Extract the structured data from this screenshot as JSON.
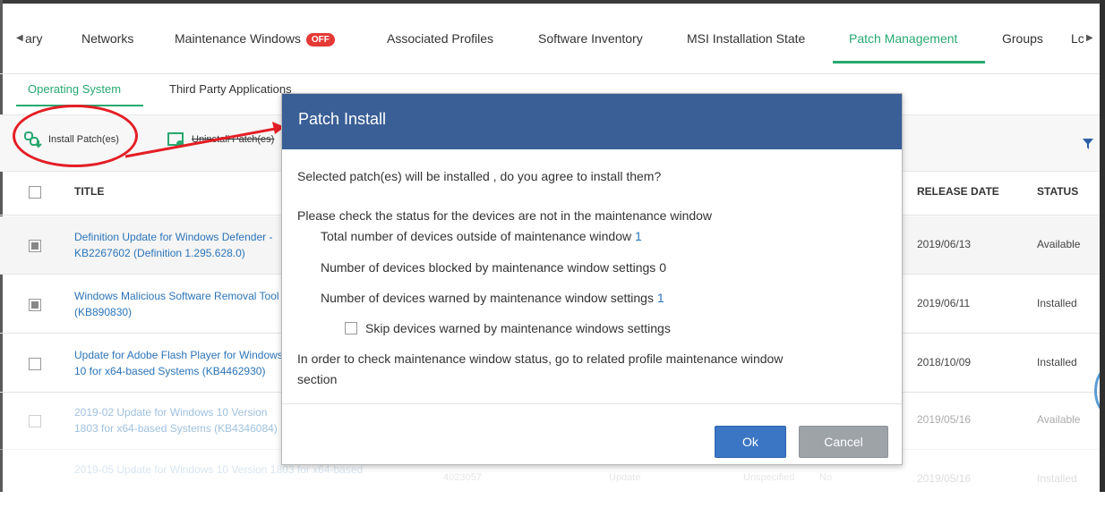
{
  "tabs": {
    "items": [
      {
        "label": "ary"
      },
      {
        "label": "Networks"
      },
      {
        "label": "Maintenance Windows",
        "badge": "OFF"
      },
      {
        "label": "Associated Profiles"
      },
      {
        "label": "Software Inventory"
      },
      {
        "label": "MSI Installation State"
      },
      {
        "label": "Patch Management",
        "active": true
      },
      {
        "label": "Groups"
      },
      {
        "label": "Lc"
      }
    ]
  },
  "subtabs": {
    "operating_system": "Operating System",
    "third_party": "Third Party Applications"
  },
  "toolbar": {
    "install_label": "Install Patch(es)",
    "uninstall_label": "Uninstall Patch(es)"
  },
  "table": {
    "headers": {
      "title": "TITLE",
      "release_date": "RELEASE DATE",
      "status": "STATUS"
    },
    "rows": [
      {
        "title": "Definition Update for Windows Defender - KB2267602 (Definition 1.295.628.0)",
        "release_date": "2019/06/13",
        "status": "Available",
        "checked": true
      },
      {
        "title": "Windows Malicious Software Removal Tool (KB890830)",
        "release_date": "2019/06/11",
        "status": "Installed",
        "checked": true
      },
      {
        "title": "Update for Adobe Flash Player for Windows 10 for x64-based Systems (KB4462930)",
        "release_date": "2018/10/09",
        "status": "Installed",
        "checked": false
      },
      {
        "title": "2019-02 Update for Windows 10 Version 1803 for x64-based Systems (KB4346084)",
        "release_date": "2019/05/16",
        "status": "Available",
        "checked": false
      },
      {
        "title": "2019-05 Update for Windows 10 Version 1803 for x64-based",
        "kb": "4023057",
        "category": "Update",
        "severity": "Unspecified",
        "reboot": "No",
        "release_date": "2019/05/16",
        "status": "Installed",
        "checked": false
      }
    ]
  },
  "modal": {
    "title": "Patch Install",
    "question": "Selected patch(es) will be installed , do you agree to install them?",
    "check_status": "Please check the status for the devices are not in the maintenance window",
    "outside_label": "Total number of devices outside of maintenance window",
    "outside_count": "1",
    "blocked_label": "Number of devices blocked by maintenance window settings",
    "blocked_count": "0",
    "warned_label": "Number of devices warned by maintenance window settings",
    "warned_count": "1",
    "skip_label": "Skip devices warned by maintenance windows settings",
    "info_line1": "In order to check maintenance window status, go to related profile maintenance window",
    "info_line2": "section",
    "ok_label": "Ok",
    "cancel_label": "Cancel"
  },
  "colors": {
    "accent_green": "#27a86f",
    "modal_header": "#3a5f96",
    "ok_button": "#3b76c5",
    "cancel_button": "#9ea3a8",
    "link_blue": "#2b74b9",
    "annotation_red": "#e41e26",
    "badge_red": "#e53935"
  }
}
